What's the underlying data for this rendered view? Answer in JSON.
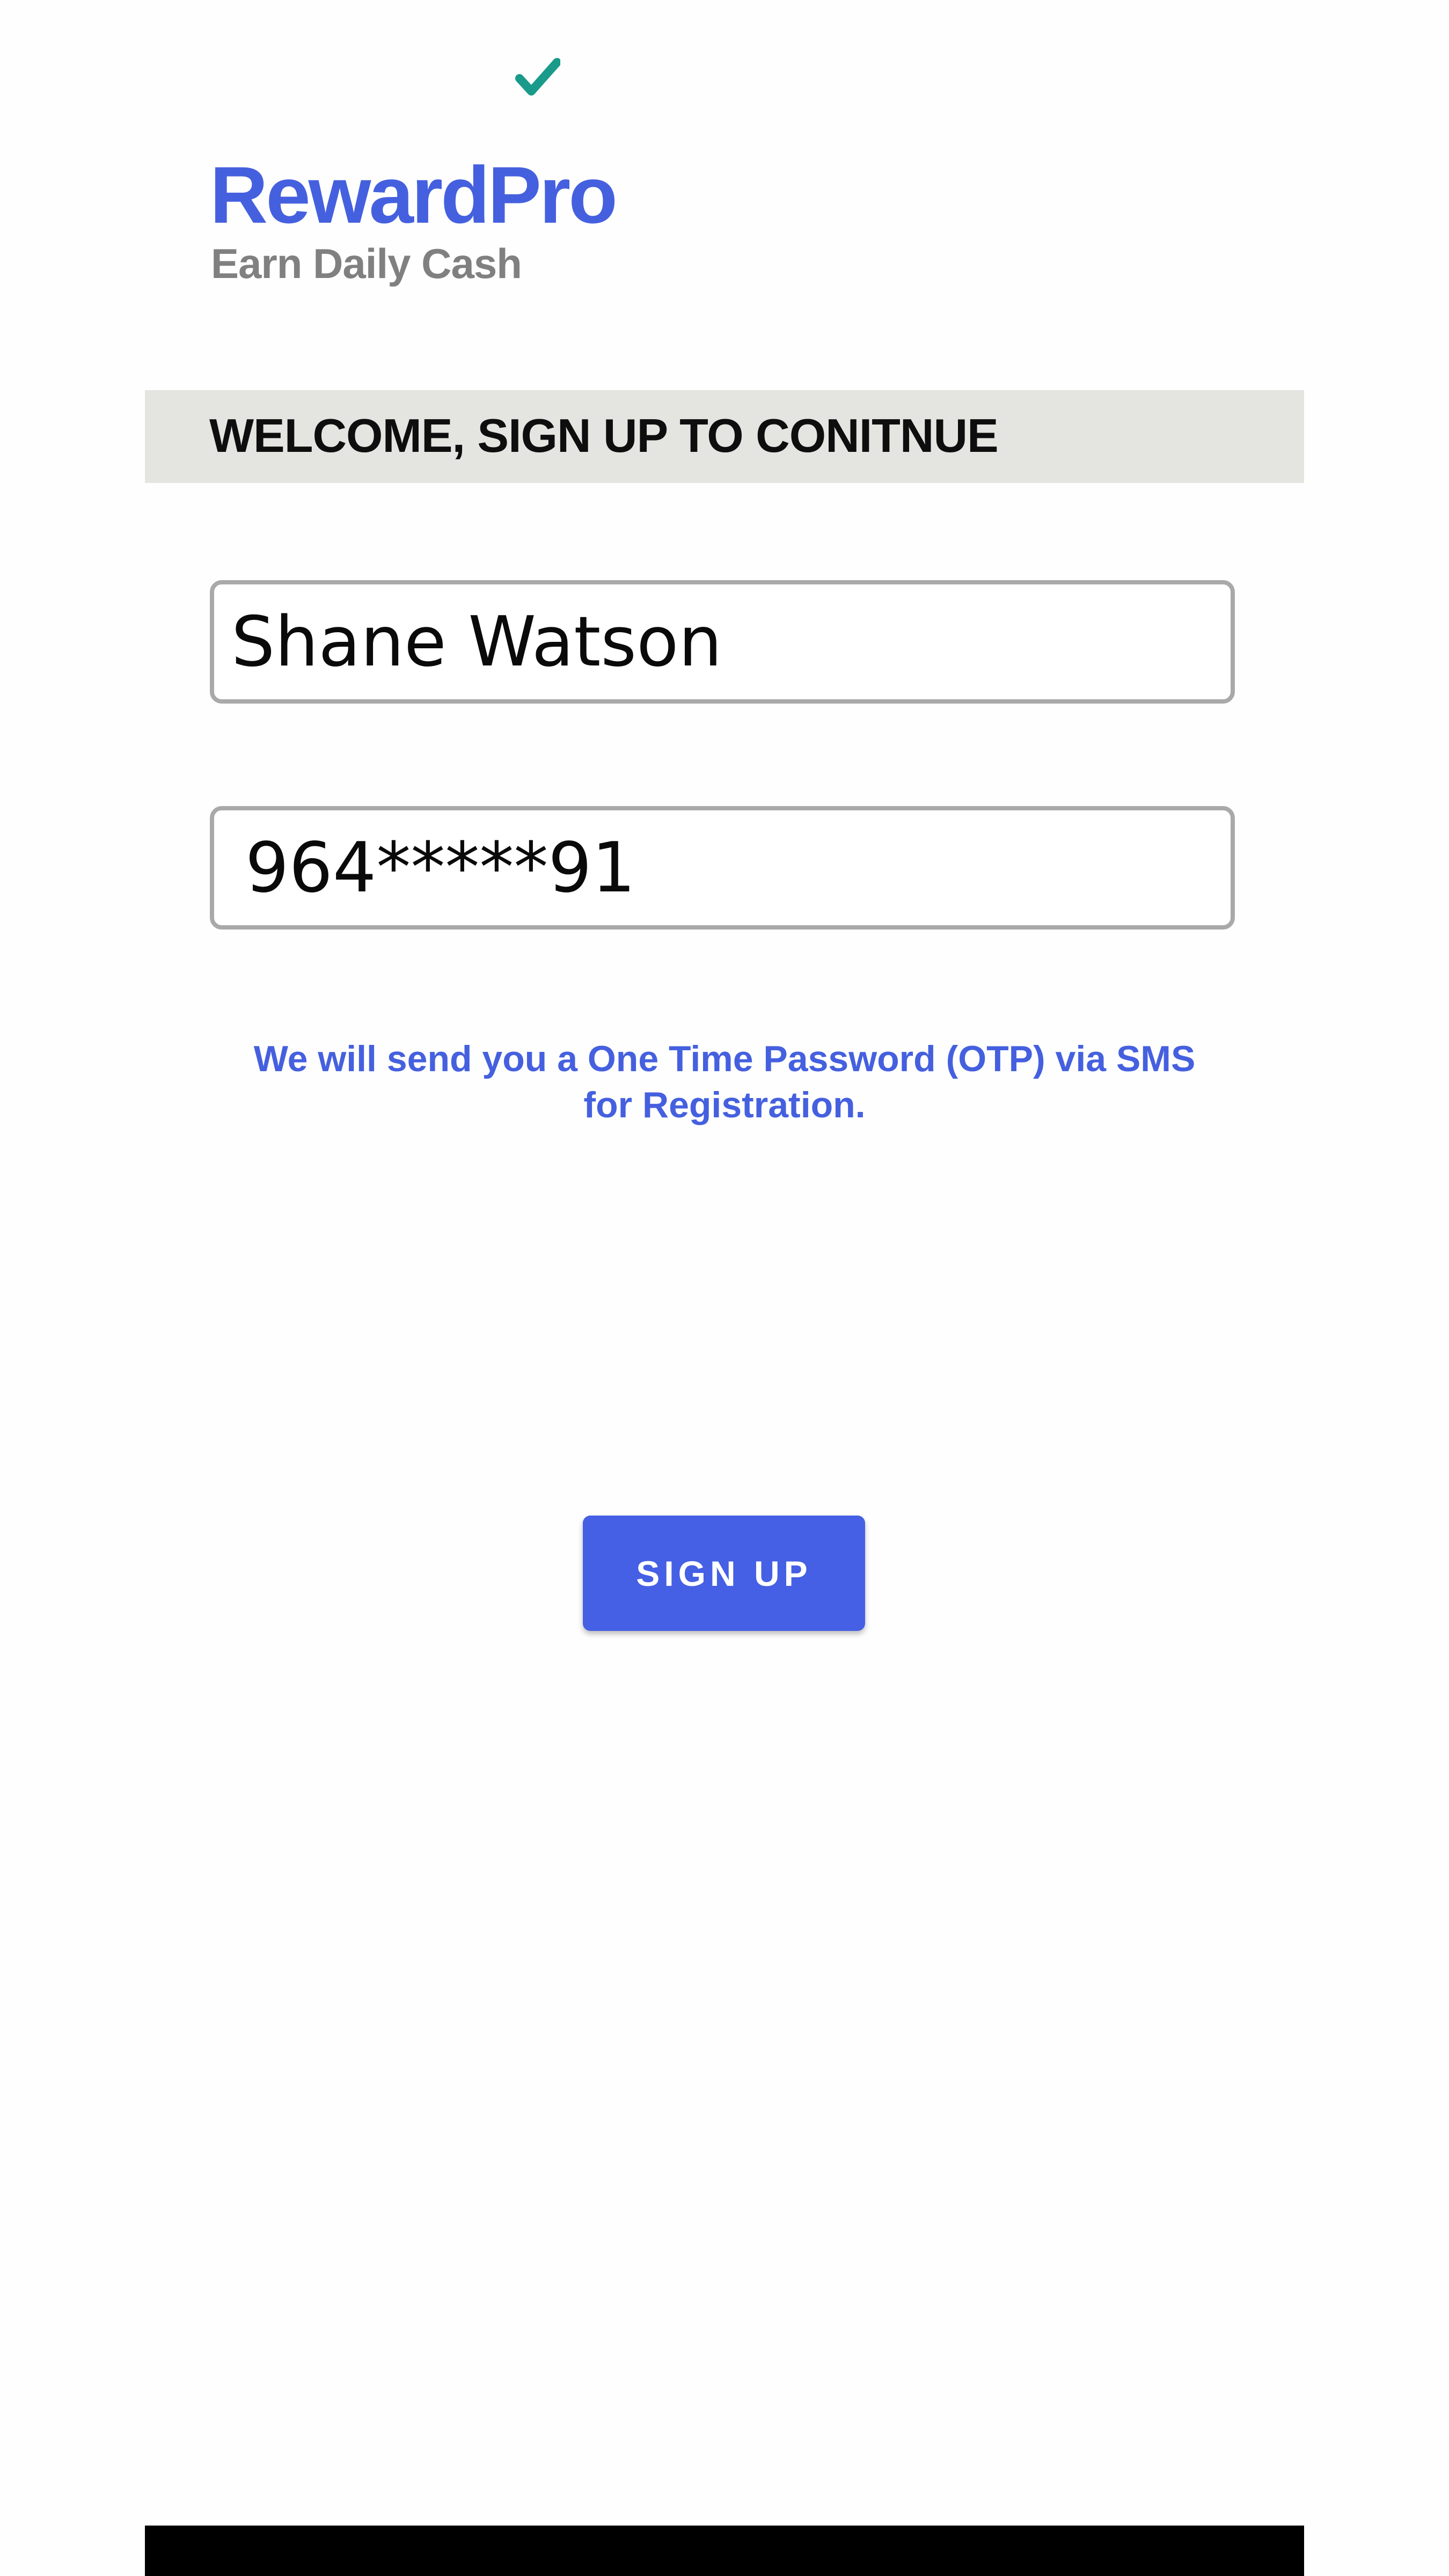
{
  "status": {
    "icon": "check-icon",
    "color": "#1a9a8a"
  },
  "logo": {
    "title": "RewardPro",
    "subtitle": "Earn Daily Cash",
    "brand_color": "#4560df"
  },
  "welcome": {
    "text": "WELCOME, SIGN UP TO CONITNUE"
  },
  "form": {
    "name_value": "Shane Watson",
    "phone_value": "964*****91"
  },
  "otp_note": {
    "line1": "We will send you a One Time Password (OTP) via SMS",
    "line2": "for Registration."
  },
  "signup_button": {
    "label": "SIGN UP",
    "color": "#4560e4"
  }
}
